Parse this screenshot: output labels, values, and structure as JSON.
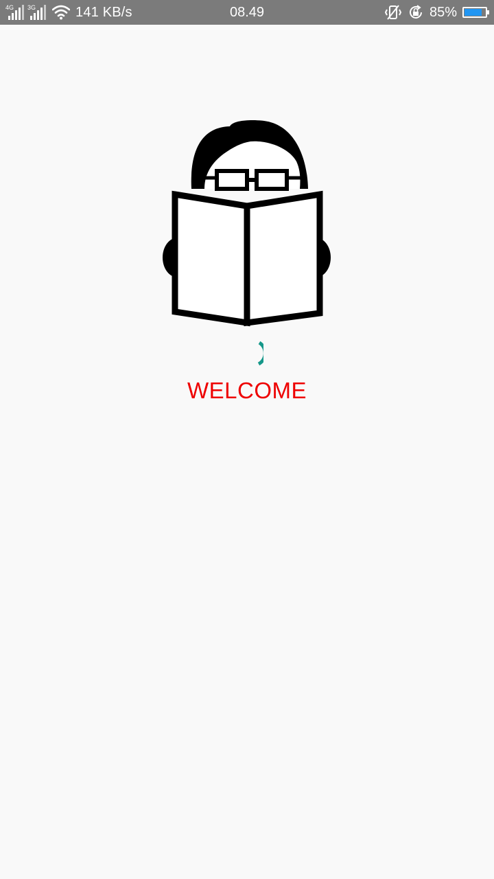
{
  "status_bar": {
    "signal_1_label": "4G",
    "signal_2_label": "3G",
    "network_speed": "141 KB/s",
    "time": "08.49",
    "battery_text": "85%",
    "battery_level": 0.85,
    "icons": [
      "signal-icon",
      "wifi-icon",
      "vibrate-icon",
      "rotation-lock-icon",
      "battery-icon"
    ]
  },
  "splash": {
    "logo": "reader-with-book-icon",
    "loading": true,
    "welcome_text": "WELCOME"
  },
  "colors": {
    "status_bar_bg": "#7b7b7b",
    "background": "#f9f9f9",
    "welcome_text": "#ee0000",
    "spinner": "#16988a",
    "battery_fill": "#2196f3"
  }
}
